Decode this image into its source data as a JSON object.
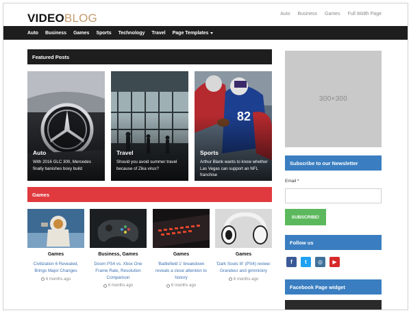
{
  "header": {
    "logo_part1": "VIDEO",
    "logo_part2": "BLOG",
    "top_links": [
      "Auto",
      "Business",
      "Games",
      "Full Width Page"
    ]
  },
  "nav": {
    "items": [
      "Auto",
      "Business",
      "Games",
      "Sports",
      "Technology",
      "Travel"
    ],
    "dropdown": "Page Templates"
  },
  "featured": {
    "heading": "Featured Posts",
    "cards": [
      {
        "category": "Auto",
        "title": "With 2016 GLC 300, Mercedes finally banishes boxy build"
      },
      {
        "category": "Travel",
        "title": "Should you avoid summer travel because of Zika virus?"
      },
      {
        "category": "Sports",
        "title": "Arthur Blank wants to know whether Las Vegas can support an NFL franchise"
      }
    ]
  },
  "games": {
    "heading": "Games",
    "cards": [
      {
        "category": "Games",
        "title": "Civilization 6 Revealed, Brings Major Changes",
        "date": "6 months ago"
      },
      {
        "category": "Business, Games",
        "title": "Doom PS4 vs. Xbox One Frame Rate, Resolution Comparison",
        "date": "6 months ago"
      },
      {
        "category": "Games",
        "title": "'Battlefield 1' breakdown reveals a close attention to history",
        "date": "6 months ago"
      },
      {
        "category": "Games",
        "title": "'Dark Souls III' (PS4) review: Grandeur and gimmickry",
        "date": "6 months ago"
      }
    ]
  },
  "sidebar": {
    "ad_label": "300×300",
    "newsletter_heading": "Subscribe to our Newsletter",
    "email_label": "Email *",
    "subscribe_label": "SUBSCRIBE!",
    "follow_heading": "Follow us",
    "fb_widget_heading": "Facebook Page widget",
    "social": [
      "f",
      "t",
      "◎",
      "▶"
    ]
  },
  "colors": {
    "nav_bg": "#1e1e1e",
    "games_red": "#e03a3f",
    "sidebar_blue": "#3a7ec1",
    "subscribe_green": "#5cb85c",
    "link_blue": "#3a6fb0",
    "logo_accent": "#c49a6c"
  }
}
